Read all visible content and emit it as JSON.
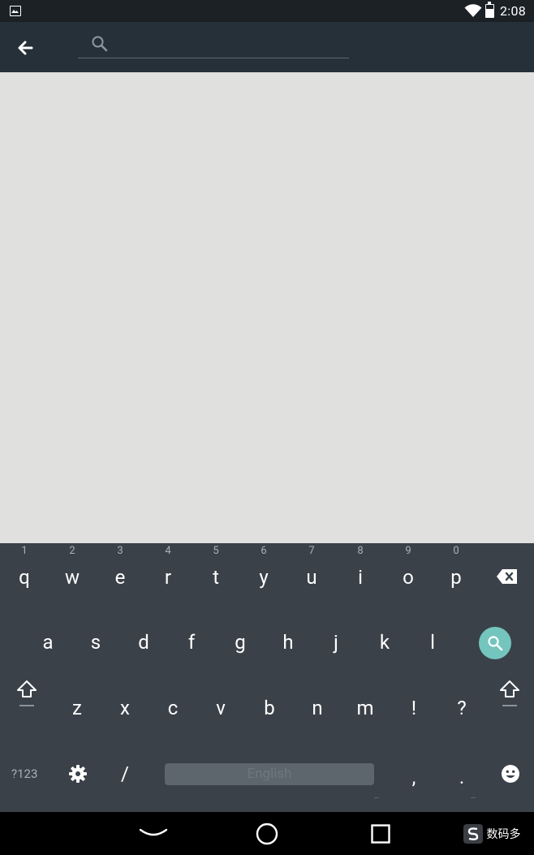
{
  "status_bar": {
    "time": "2:08"
  },
  "search": {
    "placeholder": "",
    "value": ""
  },
  "keyboard": {
    "row1": [
      {
        "label": "q",
        "hint": "1"
      },
      {
        "label": "w",
        "hint": "2"
      },
      {
        "label": "e",
        "hint": "3"
      },
      {
        "label": "r",
        "hint": "4"
      },
      {
        "label": "t",
        "hint": "5"
      },
      {
        "label": "y",
        "hint": "6"
      },
      {
        "label": "u",
        "hint": "7"
      },
      {
        "label": "i",
        "hint": "8"
      },
      {
        "label": "o",
        "hint": "9"
      },
      {
        "label": "p",
        "hint": "0"
      }
    ],
    "row2": [
      "a",
      "s",
      "d",
      "f",
      "g",
      "h",
      "j",
      "k",
      "l"
    ],
    "row3": [
      "z",
      "x",
      "c",
      "v",
      "b",
      "n",
      "m",
      "!",
      "?"
    ],
    "symbols_label": "?123",
    "slash_label": "/",
    "space_label": "English",
    "comma_label": ",",
    "period_label": "."
  },
  "watermark": {
    "text": "数码多"
  },
  "colors": {
    "app_bar": "#263039",
    "keyboard": "#3a4149",
    "accent": "#74c5bd",
    "content": "#e0e0de"
  }
}
